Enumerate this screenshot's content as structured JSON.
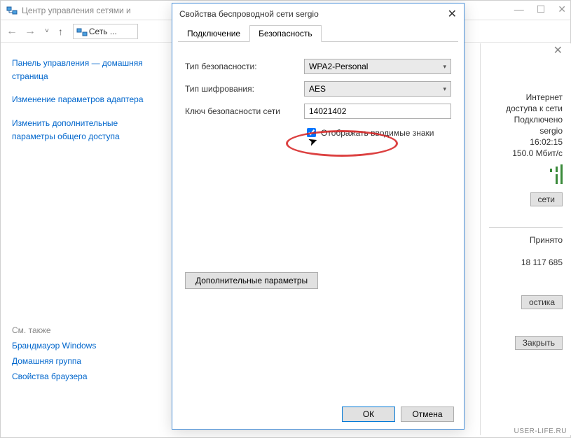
{
  "bg_window": {
    "title": "Центр управления сетями и",
    "addr": "Сеть ...",
    "win_min": "—",
    "win_max": "☐",
    "win_close": "✕"
  },
  "left": {
    "link_home": "Панель управления — домашняя страница",
    "link_adapter": "Изменение параметров адаптера",
    "link_sharing": "Изменить дополнительные параметры общего доступа",
    "see_also": "См. также",
    "firewall": "Брандмауэр Windows",
    "homegroup": "Домашняя группа",
    "browser": "Свойства браузера"
  },
  "right": {
    "internet": "Интернет",
    "net_access": "доступа к сети",
    "connected": "Подключено",
    "ssid": "sergio",
    "duration": "16:02:15",
    "speed": "150.0 Мбит/с",
    "btn_net": "сети",
    "received_label": "Принято",
    "received_value": "18 117 685",
    "btn_diag": "остика",
    "btn_close": "Закрыть"
  },
  "dialog": {
    "title": "Свойства беспроводной сети sergio",
    "close": "✕",
    "tabs": {
      "connection": "Подключение",
      "security": "Безопасность"
    },
    "labels": {
      "security_type": "Тип безопасности:",
      "encryption": "Тип шифрования:",
      "key": "Ключ безопасности сети"
    },
    "values": {
      "security_type": "WPA2-Personal",
      "encryption": "AES",
      "key": "14021402"
    },
    "show_chars": "Отображать вводимые знаки",
    "advanced": "Дополнительные параметры",
    "ok": "ОК",
    "cancel": "Отмена"
  },
  "watermark": "USER-LIFE.RU"
}
